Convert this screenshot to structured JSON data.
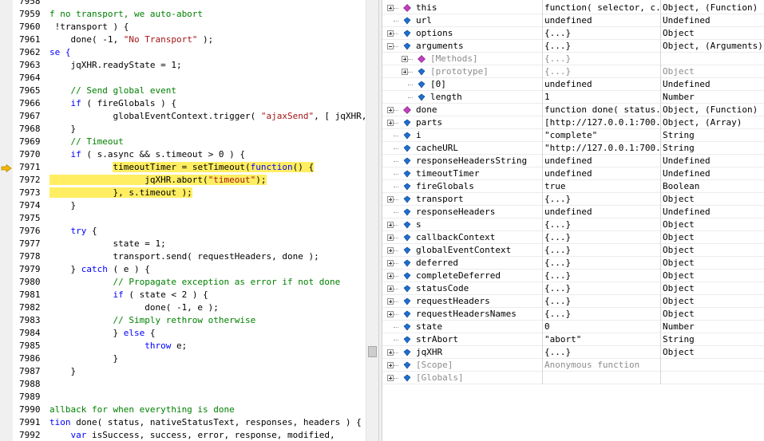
{
  "code_lines": [
    {
      "n": "7958",
      "segs": [
        {
          "t": ""
        }
      ]
    },
    {
      "n": "7959",
      "segs": [
        {
          "t": "f no transport, we auto-abort",
          "c": "cm"
        }
      ]
    },
    {
      "n": "7960",
      "segs": [
        {
          "t": " !transport ) {"
        }
      ]
    },
    {
      "n": "7961",
      "segs": [
        {
          "t": "    done( -1, "
        },
        {
          "t": "\"No Transport\"",
          "c": "st"
        },
        {
          "t": " );"
        }
      ]
    },
    {
      "n": "7962",
      "segs": [
        {
          "t": "se {",
          "c": "kw"
        }
      ]
    },
    {
      "n": "7963",
      "segs": [
        {
          "t": "    jqXHR.readyState = 1;"
        }
      ]
    },
    {
      "n": "7964",
      "segs": [
        {
          "t": ""
        }
      ]
    },
    {
      "n": "7965",
      "segs": [
        {
          "t": "    // Send global event",
          "c": "cm"
        }
      ]
    },
    {
      "n": "7966",
      "segs": [
        {
          "t": "    "
        },
        {
          "t": "if",
          "c": "kw"
        },
        {
          "t": " ( fireGlobals ) {"
        }
      ]
    },
    {
      "n": "7967",
      "segs": [
        {
          "t": "            globalEventContext.trigger( "
        },
        {
          "t": "\"ajaxSend\"",
          "c": "st"
        },
        {
          "t": ", [ jqXHR, s ] )"
        }
      ]
    },
    {
      "n": "7968",
      "segs": [
        {
          "t": "    }"
        }
      ]
    },
    {
      "n": "7969",
      "segs": [
        {
          "t": "    // Timeout",
          "c": "cm"
        }
      ]
    },
    {
      "n": "7970",
      "segs": [
        {
          "t": "    "
        },
        {
          "t": "if",
          "c": "kw"
        },
        {
          "t": " ( s.async && s.timeout > 0 ) {"
        }
      ]
    },
    {
      "n": "7971",
      "hl": true,
      "segs": [
        {
          "t": "            "
        },
        {
          "t": "timeoutTimer = setTimeout(",
          "h": true
        },
        {
          "t": "function",
          "c": "kw",
          "h": true
        },
        {
          "t": "() {",
          "h": true
        }
      ]
    },
    {
      "n": "7972",
      "hl": true,
      "segs": [
        {
          "t": "                  jqXHR.abort(",
          "h": true
        },
        {
          "t": "\"timeout\"",
          "c": "st",
          "h": true
        },
        {
          "t": ");",
          "h": true
        }
      ]
    },
    {
      "n": "7973",
      "hl": true,
      "segs": [
        {
          "t": "            }, s.timeout );",
          "h": true
        }
      ]
    },
    {
      "n": "7974",
      "segs": [
        {
          "t": "    }"
        }
      ]
    },
    {
      "n": "7975",
      "segs": [
        {
          "t": ""
        }
      ]
    },
    {
      "n": "7976",
      "segs": [
        {
          "t": "    "
        },
        {
          "t": "try",
          "c": "kw"
        },
        {
          "t": " {"
        }
      ]
    },
    {
      "n": "7977",
      "segs": [
        {
          "t": "            state = 1;"
        }
      ]
    },
    {
      "n": "7978",
      "segs": [
        {
          "t": "            transport.send( requestHeaders, done );"
        }
      ]
    },
    {
      "n": "7979",
      "segs": [
        {
          "t": "    } "
        },
        {
          "t": "catch",
          "c": "kw"
        },
        {
          "t": " ( e ) {"
        }
      ]
    },
    {
      "n": "7980",
      "segs": [
        {
          "t": "            // Propagate exception as error if not done",
          "c": "cm"
        }
      ]
    },
    {
      "n": "7981",
      "segs": [
        {
          "t": "            "
        },
        {
          "t": "if",
          "c": "kw"
        },
        {
          "t": " ( state < 2 ) {"
        }
      ]
    },
    {
      "n": "7982",
      "segs": [
        {
          "t": "                  done( -1, e );"
        }
      ]
    },
    {
      "n": "7983",
      "segs": [
        {
          "t": "            // Simply rethrow otherwise",
          "c": "cm"
        }
      ]
    },
    {
      "n": "7984",
      "segs": [
        {
          "t": "            } "
        },
        {
          "t": "else",
          "c": "kw"
        },
        {
          "t": " {"
        }
      ]
    },
    {
      "n": "7985",
      "segs": [
        {
          "t": "                  "
        },
        {
          "t": "throw",
          "c": "kw"
        },
        {
          "t": " e;"
        }
      ]
    },
    {
      "n": "7986",
      "segs": [
        {
          "t": "            }"
        }
      ]
    },
    {
      "n": "7987",
      "segs": [
        {
          "t": "    }"
        }
      ]
    },
    {
      "n": "7988",
      "segs": [
        {
          "t": ""
        }
      ]
    },
    {
      "n": "7989",
      "segs": [
        {
          "t": ""
        }
      ]
    },
    {
      "n": "7990",
      "segs": [
        {
          "t": "allback for when everything is done",
          "c": "cm"
        }
      ]
    },
    {
      "n": "7991",
      "segs": [
        {
          "t": "tion",
          "c": "kw"
        },
        {
          "t": " done( status, nativeStatusText, responses, headers ) {"
        }
      ]
    },
    {
      "n": "7992",
      "segs": [
        {
          "t": "    "
        },
        {
          "t": "var",
          "c": "kw"
        },
        {
          "t": " isSuccess, success, error, response, modified,"
        }
      ]
    }
  ],
  "watch": {
    "columns": {
      "name": "",
      "value": "",
      "type": ""
    },
    "rows": [
      {
        "name": "this",
        "value": "function( selector, c...",
        "type": "Object, (Function)",
        "level": 0,
        "exp": "plus",
        "icon": "method"
      },
      {
        "name": "url",
        "value": "undefined",
        "type": "Undefined",
        "level": 0,
        "exp": "",
        "icon": "field"
      },
      {
        "name": "options",
        "value": "{...}",
        "type": "Object",
        "level": 0,
        "exp": "plus",
        "icon": "field"
      },
      {
        "name": "arguments",
        "value": "{...}",
        "type": "Object, (Arguments)",
        "level": 0,
        "exp": "minus",
        "icon": "field"
      },
      {
        "name": "[Methods]",
        "value": "{...}",
        "type": "",
        "level": 1,
        "exp": "plus",
        "icon": "method",
        "grey": true
      },
      {
        "name": "[prototype]",
        "value": "{...}",
        "type": "Object",
        "level": 1,
        "exp": "plus",
        "icon": "field",
        "grey": true
      },
      {
        "name": "[0]",
        "value": "undefined",
        "type": "Undefined",
        "level": 1,
        "exp": "",
        "icon": "field"
      },
      {
        "name": "length",
        "value": "1",
        "type": "Number",
        "level": 1,
        "exp": "",
        "icon": "field"
      },
      {
        "name": "done",
        "value": "function done( status...",
        "type": "Object, (Function)",
        "level": 0,
        "exp": "plus",
        "icon": "method"
      },
      {
        "name": "parts",
        "value": "[http://127.0.0.1:700...",
        "type": "Object, (Array)",
        "level": 0,
        "exp": "plus",
        "icon": "field"
      },
      {
        "name": "i",
        "value": "\"complete\"",
        "type": "String",
        "level": 0,
        "exp": "",
        "icon": "field"
      },
      {
        "name": "cacheURL",
        "value": "\"http://127.0.0.1:700...",
        "type": "String",
        "level": 0,
        "exp": "",
        "icon": "field"
      },
      {
        "name": "responseHeadersString",
        "value": "undefined",
        "type": "Undefined",
        "level": 0,
        "exp": "",
        "icon": "field"
      },
      {
        "name": "timeoutTimer",
        "value": "undefined",
        "type": "Undefined",
        "level": 0,
        "exp": "",
        "icon": "field"
      },
      {
        "name": "fireGlobals",
        "value": "true",
        "type": "Boolean",
        "level": 0,
        "exp": "",
        "icon": "field"
      },
      {
        "name": "transport",
        "value": "{...}",
        "type": "Object",
        "level": 0,
        "exp": "plus",
        "icon": "field"
      },
      {
        "name": "responseHeaders",
        "value": "undefined",
        "type": "Undefined",
        "level": 0,
        "exp": "",
        "icon": "field"
      },
      {
        "name": "s",
        "value": "{...}",
        "type": "Object",
        "level": 0,
        "exp": "plus",
        "icon": "field"
      },
      {
        "name": "callbackContext",
        "value": "{...}",
        "type": "Object",
        "level": 0,
        "exp": "plus",
        "icon": "field"
      },
      {
        "name": "globalEventContext",
        "value": "{...}",
        "type": "Object",
        "level": 0,
        "exp": "plus",
        "icon": "field"
      },
      {
        "name": "deferred",
        "value": "{...}",
        "type": "Object",
        "level": 0,
        "exp": "plus",
        "icon": "field"
      },
      {
        "name": "completeDeferred",
        "value": "{...}",
        "type": "Object",
        "level": 0,
        "exp": "plus",
        "icon": "field"
      },
      {
        "name": "statusCode",
        "value": "{...}",
        "type": "Object",
        "level": 0,
        "exp": "plus",
        "icon": "field"
      },
      {
        "name": "requestHeaders",
        "value": "{...}",
        "type": "Object",
        "level": 0,
        "exp": "plus",
        "icon": "field"
      },
      {
        "name": "requestHeadersNames",
        "value": "{...}",
        "type": "Object",
        "level": 0,
        "exp": "plus",
        "icon": "field"
      },
      {
        "name": "state",
        "value": "0",
        "type": "Number",
        "level": 0,
        "exp": "",
        "icon": "field"
      },
      {
        "name": "strAbort",
        "value": "\"abort\"",
        "type": "String",
        "level": 0,
        "exp": "",
        "icon": "field"
      },
      {
        "name": "jqXHR",
        "value": "{...}",
        "type": "Object",
        "level": 0,
        "exp": "plus",
        "icon": "field"
      },
      {
        "name": "[Scope]",
        "value": "Anonymous function",
        "type": "",
        "level": 0,
        "exp": "plus",
        "icon": "field",
        "grey": true
      },
      {
        "name": "[Globals]",
        "value": "",
        "type": "",
        "level": 0,
        "exp": "plus",
        "icon": "field",
        "grey": true
      }
    ]
  },
  "colors": {
    "highlight": "#ffee62",
    "keyword": "#0000ff",
    "comment": "#008000",
    "string": "#a31515",
    "exec_arrow": "#f5b800"
  },
  "icons": {
    "exec_arrow": "current-statement-arrow-icon",
    "method": "method-icon",
    "field": "field-icon"
  }
}
